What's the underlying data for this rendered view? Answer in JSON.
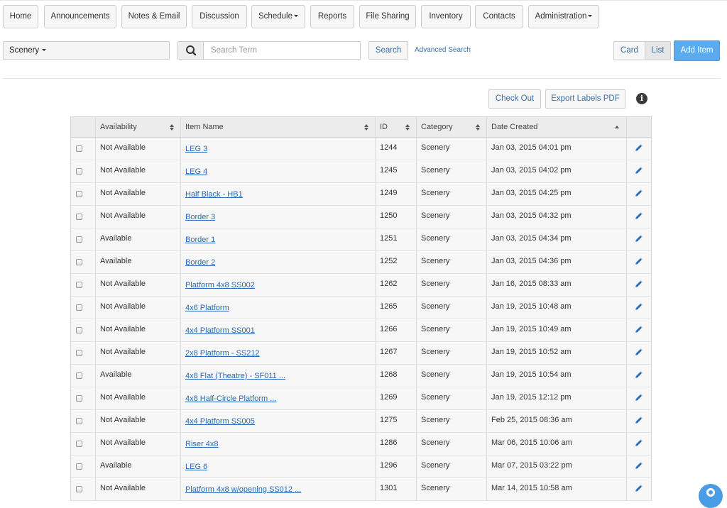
{
  "nav": {
    "items": [
      {
        "label": "Home"
      },
      {
        "label": "Announcements"
      },
      {
        "label": "Notes & Email"
      },
      {
        "label": "Discussion"
      },
      {
        "label": "Schedule",
        "dropdown": true
      },
      {
        "label": "Reports"
      },
      {
        "label": "File Sharing"
      },
      {
        "label": "Inventory"
      },
      {
        "label": "Contacts"
      },
      {
        "label": "Administration",
        "dropdown": true
      }
    ]
  },
  "toolbar": {
    "category_selected": "Scenery",
    "search_placeholder": "Search Term",
    "search_value": "",
    "search_label": "Search",
    "advanced_search_label": "Advanced Search",
    "view_card_label": "Card",
    "view_list_label": "List",
    "active_view": "List",
    "add_item_label": "Add Item"
  },
  "actions": {
    "check_out_label": "Check Out",
    "export_labels_label": "Export Labels PDF"
  },
  "table": {
    "columns": [
      {
        "label": "Availability",
        "sort": "both"
      },
      {
        "label": "Item Name",
        "sort": "both"
      },
      {
        "label": "ID",
        "sort": "both"
      },
      {
        "label": "Category",
        "sort": "both"
      },
      {
        "label": "Date Created",
        "sort": "asc"
      }
    ],
    "rows": [
      {
        "availability": "Not Available",
        "name": "LEG 3",
        "id": "1244",
        "category": "Scenery",
        "date": "Jan 03, 2015 04:01 pm"
      },
      {
        "availability": "Not Available",
        "name": "LEG 4",
        "id": "1245",
        "category": "Scenery",
        "date": "Jan 03, 2015 04:02 pm"
      },
      {
        "availability": "Not Available",
        "name": "Half Black - HB1",
        "id": "1249",
        "category": "Scenery",
        "date": "Jan 03, 2015 04:25 pm"
      },
      {
        "availability": "Not Available",
        "name": "Border 3",
        "id": "1250",
        "category": "Scenery",
        "date": "Jan 03, 2015 04:32 pm"
      },
      {
        "availability": "Available",
        "name": "Border 1",
        "id": "1251",
        "category": "Scenery",
        "date": "Jan 03, 2015 04:34 pm"
      },
      {
        "availability": "Available",
        "name": "Border 2",
        "id": "1252",
        "category": "Scenery",
        "date": "Jan 03, 2015 04:36 pm"
      },
      {
        "availability": "Not Available",
        "name": "Platform 4x8 SS002",
        "id": "1262",
        "category": "Scenery",
        "date": "Jan 16, 2015 08:33 am"
      },
      {
        "availability": "Not Available",
        "name": "4x6 Platform",
        "id": "1265",
        "category": "Scenery",
        "date": "Jan 19, 2015 10:48 am"
      },
      {
        "availability": "Not Available",
        "name": "4x4 Platform SS001",
        "id": "1266",
        "category": "Scenery",
        "date": "Jan 19, 2015 10:49 am"
      },
      {
        "availability": "Not Available",
        "name": "2x8 Platform - SS212",
        "id": "1267",
        "category": "Scenery",
        "date": "Jan 19, 2015 10:52 am"
      },
      {
        "availability": "Available",
        "name": "4x8 Flat (Theatre) - SF011 ...",
        "id": "1268",
        "category": "Scenery",
        "date": "Jan 19, 2015 10:54 am"
      },
      {
        "availability": "Not Available",
        "name": "4x8 Half-Circle Platform ...",
        "id": "1269",
        "category": "Scenery",
        "date": "Jan 19, 2015 12:12 pm"
      },
      {
        "availability": "Not Available",
        "name": "4x4 Platform SS005",
        "id": "1275",
        "category": "Scenery",
        "date": "Feb 25, 2015 08:36 am"
      },
      {
        "availability": "Not Available",
        "name": "Riser 4x8",
        "id": "1286",
        "category": "Scenery",
        "date": "Mar 06, 2015 10:06 am"
      },
      {
        "availability": "Available",
        "name": "LEG 6",
        "id": "1296",
        "category": "Scenery",
        "date": "Mar 07, 2015 03:22 pm"
      },
      {
        "availability": "Not Available",
        "name": "Platform 4x8 w/opening SS012 ...",
        "id": "1301",
        "category": "Scenery",
        "date": "Mar 14, 2015 10:58 am"
      }
    ]
  },
  "colors": {
    "link": "#2a68b8",
    "primary_button": "#5aabf0",
    "header_bg": "#ececec"
  },
  "icons": {
    "search": "search-icon",
    "info": "info-icon",
    "edit": "pencil-icon",
    "help": "help-bubble-icon"
  }
}
